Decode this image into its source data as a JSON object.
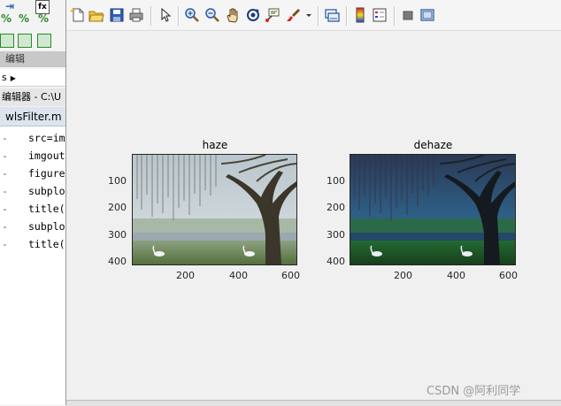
{
  "editor": {
    "section_label": "编辑",
    "path_text": "s",
    "title_text": "编辑器 - C:\\U",
    "tab_label": "wlsFilter.m",
    "code_lines": [
      "src=im",
      "imgout",
      "figure",
      "subplo",
      "title(",
      "subplo",
      "title("
    ]
  },
  "figure": {
    "toolbar_icons": [
      "new-figure-icon",
      "open-file-icon",
      "save-icon",
      "print-icon",
      "pointer-icon",
      "zoom-in-icon",
      "zoom-out-icon",
      "pan-hand-icon",
      "rotate-3d-icon",
      "data-cursor-icon",
      "brush-icon",
      "dropdown-arrow-icon",
      "link-plot-icon",
      "colorbar-icon",
      "legend-icon",
      "hide-plot-tools-icon",
      "show-plot-tools-icon"
    ],
    "subplots": [
      {
        "title": "haze",
        "x_ticks": [
          "200",
          "400",
          "600"
        ],
        "y_ticks": [
          "100",
          "200",
          "300",
          "400"
        ],
        "image_style": "haze"
      },
      {
        "title": "dehaze",
        "x_ticks": [
          "200",
          "400",
          "600"
        ],
        "y_ticks": [
          "100",
          "200",
          "300",
          "400"
        ],
        "image_style": "dehaze"
      }
    ],
    "watermark": "CSDN @阿利同学"
  },
  "colors": {
    "figure_bg": "#f0f0f0",
    "axes_border": "#262626"
  }
}
